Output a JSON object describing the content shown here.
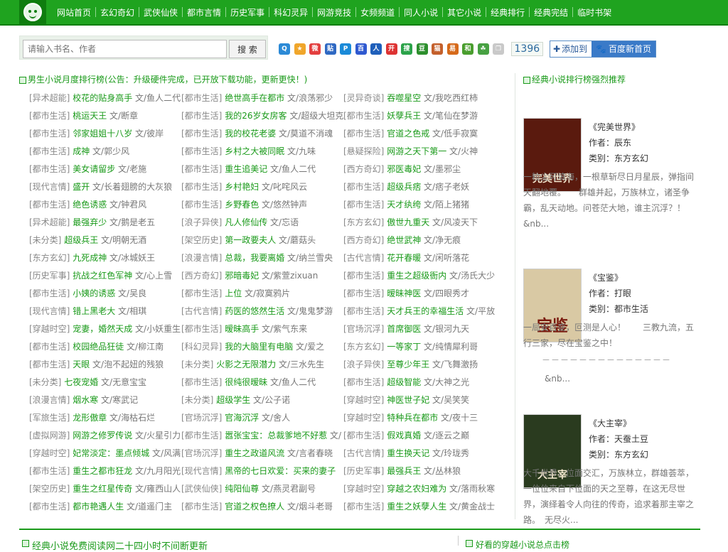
{
  "nav": {
    "items": [
      "网站首页",
      "玄幻奇幻",
      "武侠仙侠",
      "都市言情",
      "历史军事",
      "科幻灵异",
      "网游竞技",
      "女频频道",
      "同人小说",
      "其它小说",
      "经典排行",
      "经典完结",
      "临时书架"
    ]
  },
  "search": {
    "placeholder": "请输入书名、作者",
    "button": "搜 索"
  },
  "share": {
    "icons": [
      {
        "name": "qq-icon",
        "color": "#2c8ad6",
        "glyph": "Q"
      },
      {
        "name": "qzone-icon",
        "color": "#f0a62b",
        "glyph": "★"
      },
      {
        "name": "weibo-icon",
        "color": "#e33f3f",
        "glyph": "微"
      },
      {
        "name": "tieba-icon",
        "color": "#2f69c3",
        "glyph": "贴"
      },
      {
        "name": "pengyou-icon",
        "color": "#1a8ad8",
        "glyph": "P"
      },
      {
        "name": "baidu-icon",
        "color": "#2f59d0",
        "glyph": "百"
      },
      {
        "name": "renren-icon",
        "color": "#1f5fba",
        "glyph": "人"
      },
      {
        "name": "kaixin-icon",
        "color": "#d33",
        "glyph": "开"
      },
      {
        "name": "sohu-icon",
        "color": "#2ca34a",
        "glyph": "搜"
      },
      {
        "name": "douban-icon",
        "color": "#2d8f2d",
        "glyph": "豆"
      },
      {
        "name": "mop-icon",
        "color": "#c4602c",
        "glyph": "猫"
      },
      {
        "name": "netease-icon",
        "color": "#d66a1b",
        "glyph": "易"
      },
      {
        "name": "hexun-icon",
        "color": "#4a9e2e",
        "glyph": "和"
      },
      {
        "name": "clover-icon",
        "color": "#47a142",
        "glyph": "☘"
      },
      {
        "name": "copy-icon",
        "color": "#c9c9c9",
        "glyph": "❐"
      }
    ],
    "count": "1396"
  },
  "addto": {
    "left": "添加到",
    "right": "百度新首页"
  },
  "main": {
    "title": "男生小说月度排行榜(公告：升级硬件完成，已开放下载功能，更新更快！)",
    "columns": [
      [
        {
          "cat": "[异术超能]",
          "book": "校花的贴身高手",
          "author": "文/鱼人二代"
        },
        {
          "cat": "[都市生活]",
          "book": "桃运天王",
          "author": "文/断章"
        },
        {
          "cat": "[都市生活]",
          "book": "邻家姐姐十八岁",
          "author": "文/彼岸"
        },
        {
          "cat": "[都市生活]",
          "book": "成神",
          "author": "文/郭少风"
        },
        {
          "cat": "[都市生活]",
          "book": "美女请留步",
          "author": "文/老施"
        },
        {
          "cat": "[现代言情]",
          "book": "盛开",
          "author": "文/长着翅膀的大灰狼"
        },
        {
          "cat": "[都市生活]",
          "book": "绝色诱惑",
          "author": "文/钟君风"
        },
        {
          "cat": "[异术超能]",
          "book": "最强弃少",
          "author": "文/鹅是老五"
        },
        {
          "cat": "[未分类]",
          "book": "超级兵王",
          "author": "文/明朝无酒"
        },
        {
          "cat": "[东方玄幻]",
          "book": "九死成神",
          "author": "文/冰城妖王"
        },
        {
          "cat": "[历史军事]",
          "book": "抗战之红色军神",
          "author": "文/心上雪"
        },
        {
          "cat": "[都市生活]",
          "book": "小姨的诱惑",
          "author": "文/吴良"
        },
        {
          "cat": "[现代言情]",
          "book": "错上黑老大",
          "author": "文/相琪"
        },
        {
          "cat": "[穿越时空]",
          "book": "宠妻，婚然天成",
          "author": "文/小妖重生"
        },
        {
          "cat": "[都市生活]",
          "book": "校园绝品狂徒",
          "author": "文/柳江南"
        },
        {
          "cat": "[都市生活]",
          "book": "天眼",
          "author": "文/泡不起妞的残狼"
        },
        {
          "cat": "[未分类]",
          "book": "七夜宠婚",
          "author": "文/无意宝宝"
        },
        {
          "cat": "[浪漫言情]",
          "book": "烟水寒",
          "author": "文/寒武记"
        },
        {
          "cat": "[军旅生活]",
          "book": "龙形傲章",
          "author": "文/海枯石烂"
        },
        {
          "cat": "[虚拟网游]",
          "book": "网游之修罗传说",
          "author": "文/火星引力"
        },
        {
          "cat": "[穿越时空]",
          "book": "妃常淡定：墨点倾城",
          "author": "文/风满渡"
        },
        {
          "cat": "[都市生活]",
          "book": "重生之都市狂龙",
          "author": "文/九月阳光"
        },
        {
          "cat": "[架空历史]",
          "book": "重生之红星传奇",
          "author": "文/雍西山人"
        },
        {
          "cat": "[都市生活]",
          "book": "都市艳遇人生",
          "author": "文/道遥门主"
        }
      ],
      [
        {
          "cat": "[都市生活]",
          "book": "绝世高手在都市",
          "author": "文/浪荡邪少"
        },
        {
          "cat": "[都市生活]",
          "book": "我的26岁女房客",
          "author": "文/超级大坦克"
        },
        {
          "cat": "[都市生活]",
          "book": "我的校花老婆",
          "author": "文/莫道不消魂"
        },
        {
          "cat": "[都市生活]",
          "book": "乡村之大被同眠",
          "author": "文/九味"
        },
        {
          "cat": "[都市生活]",
          "book": "重生追美记",
          "author": "文/鱼人二代"
        },
        {
          "cat": "[都市生活]",
          "book": "乡村艳妇",
          "author": "文/叱咤风云"
        },
        {
          "cat": "[都市生活]",
          "book": "乡野春色",
          "author": "文/悠然钟声"
        },
        {
          "cat": "[浪子异侠]",
          "book": "凡人修仙传",
          "author": "文/忘语"
        },
        {
          "cat": "[架空历史]",
          "book": "第一政要夫人",
          "author": "文/蘑菇头"
        },
        {
          "cat": "[浪漫言情]",
          "book": "总裁，我要离婚",
          "author": "文/纳兰雪央"
        },
        {
          "cat": "[西方奇幻]",
          "book": "邪暗毒妃",
          "author": "文/紫萱zixuan"
        },
        {
          "cat": "[都市生活]",
          "book": "上位",
          "author": "文/寂寞鸦片"
        },
        {
          "cat": "[古代言情]",
          "book": "药医的悠然生活",
          "author": "文/鬼鬼梦游"
        },
        {
          "cat": "[都市生活]",
          "book": "暧昧高手",
          "author": "文/紫气东来"
        },
        {
          "cat": "[科幻灵异]",
          "book": "我的大脑里有电脑",
          "author": "文/爱之"
        },
        {
          "cat": "[未分类]",
          "book": "火影之无限潜力",
          "author": "文/三水先生"
        },
        {
          "cat": "[都市生活]",
          "book": "很纯很暧昧",
          "author": "文/鱼人二代"
        },
        {
          "cat": "[未分类]",
          "book": "超级学生",
          "author": "文/公子诺"
        },
        {
          "cat": "[官场沉浮]",
          "book": "官海沉浮",
          "author": "文/舍人"
        },
        {
          "cat": "[都市生活]",
          "book": "嚣张宝宝：总裁爹地不好惹",
          "author": "文/"
        },
        {
          "cat": "[官场沉浮]",
          "book": "重生之政道风流",
          "author": "文/言者春晓"
        },
        {
          "cat": "[现代言情]",
          "book": "黑帝的七日欢爱：买来的妻子",
          "author": ""
        },
        {
          "cat": "[武侠仙侠]",
          "book": "纯阳仙尊",
          "author": "文/燕灵君副号"
        },
        {
          "cat": "[都市生活]",
          "book": "官道之权色撩人",
          "author": "文/烟斗老哥"
        }
      ],
      [
        {
          "cat": "[灵异奇谈]",
          "book": "吞噬星空",
          "author": "文/我吃西红柿"
        },
        {
          "cat": "[都市生活]",
          "book": "妖孽兵王",
          "author": "文/笔仙在梦游"
        },
        {
          "cat": "[都市生活]",
          "book": "官道之色戒",
          "author": "文/低手寂寞"
        },
        {
          "cat": "[悬疑探险]",
          "book": "网游之天下第一",
          "author": "文/火神"
        },
        {
          "cat": "[西方奇幻]",
          "book": "邪医毒妃",
          "author": "文/墨邪尘"
        },
        {
          "cat": "[都市生活]",
          "book": "超级兵痞",
          "author": "文/痞子老妖"
        },
        {
          "cat": "[都市生活]",
          "book": "天才纨绔",
          "author": "文/陌上猪猪"
        },
        {
          "cat": "[东方玄幻]",
          "book": "傲世九重天",
          "author": "文/风凌天下"
        },
        {
          "cat": "[西方奇幻]",
          "book": "绝世武神",
          "author": "文/净无痕"
        },
        {
          "cat": "[古代言情]",
          "book": "花开春暖",
          "author": "文/闲听落花"
        },
        {
          "cat": "[都市生活]",
          "book": "重生之超级衙内",
          "author": "文/汤氏大少"
        },
        {
          "cat": "[都市生活]",
          "book": "暧昧神医",
          "author": "文/四眼秀才"
        },
        {
          "cat": "[都市生活]",
          "book": "天才兵王的幸福生活",
          "author": "文/平放"
        },
        {
          "cat": "[官场沉浮]",
          "book": "首席御医",
          "author": "文/银河九天"
        },
        {
          "cat": "[东方玄幻]",
          "book": "一等家丁",
          "author": "文/纯情犀利哥"
        },
        {
          "cat": "[浪子异侠]",
          "book": "至尊少年王",
          "author": "文/飞舞激扬"
        },
        {
          "cat": "[都市生活]",
          "book": "超级智能",
          "author": "文/大神之光"
        },
        {
          "cat": "[穿越时空]",
          "book": "神医世子妃",
          "author": "文/吴笑笑"
        },
        {
          "cat": "[穿越时空]",
          "book": "特种兵在都市",
          "author": "文/夜十三"
        },
        {
          "cat": "[都市生活]",
          "book": "假戏真婚",
          "author": "文/逐云之巅"
        },
        {
          "cat": "[古代言情]",
          "book": "重生换天记",
          "author": "文/玲珑秀"
        },
        {
          "cat": "[历史军事]",
          "book": "最强兵王",
          "author": "文/丛林狼"
        },
        {
          "cat": "[穿越时空]",
          "book": "穿越之农妇难为",
          "author": "文/落雨秋寒"
        },
        {
          "cat": "[都市生活]",
          "book": "重生之妖孽人生",
          "author": "文/黄金战士"
        }
      ]
    ]
  },
  "side": {
    "title": "经典小说排行榜强烈推荐",
    "books": [
      {
        "title": "《完美世界》",
        "author_label": "作者：",
        "author": "辰东",
        "cat_label": "类别：",
        "cat": "东方玄幻",
        "desc": "一粒尘可填海，一根草斩尽日月星辰，弹指间天翻地覆。　　群雄并起，万族林立，诸圣争霸，乱天动地。问苍茫大地，谁主沉浮？！　　&nb...",
        "cover_title": "完美世界",
        "cover_color": "#5a1a0e"
      },
      {
        "title": "《宝鉴》",
        "author_label": "作者：",
        "author": "打眼",
        "cat_label": "类别：",
        "cat": "都市生活",
        "desc": "一局安百变，叵测是人心！　　三教九流，五行三家，尽在宝鉴之中！",
        "cover_title": "宝鉴",
        "cover_color": "#d9c9a4"
      },
      {
        "title": "《大主宰》",
        "author_label": "作者：",
        "author": "天蚕土豆",
        "cat_label": "类别：",
        "cat": "东方玄幻",
        "desc": "大千世界，位面交汇，万族林立，群雄荟萃，一位位来自下位面的天之至尊，在这无尽世界，演绎着令人向往的传奇，追求着那主宰之路。　无尽火...",
        "cover_title": "大主宰",
        "cover_color": "#2a3b1f"
      }
    ],
    "dashes": "－－－－－－－－－－－－－－",
    "dash_tail": "&nb..."
  },
  "bottom": {
    "left_title": "经典小说免费阅读网二十四小时不间断更新",
    "right_title": "好看的穿越小说总点击榜"
  }
}
